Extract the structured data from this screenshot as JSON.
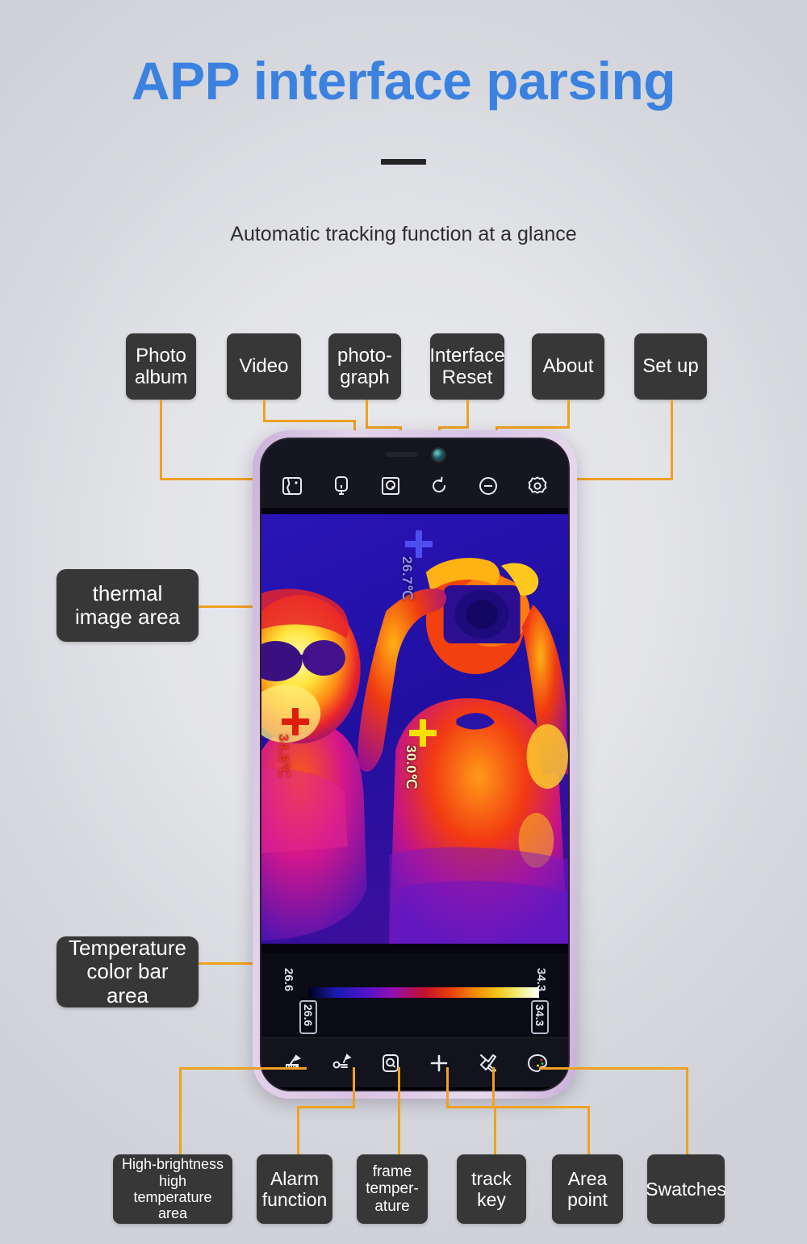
{
  "header": {
    "title": "APP interface parsing",
    "subtitle": "Automatic tracking function at a glance"
  },
  "top_callouts": [
    {
      "label": "Photo album",
      "icon": "photo-album-icon"
    },
    {
      "label": "Video",
      "icon": "video-icon"
    },
    {
      "label": "photo-graph",
      "icon": "photograph-icon"
    },
    {
      "label": "Interface Reset",
      "icon": "interface-reset-icon"
    },
    {
      "label": "About",
      "icon": "about-icon"
    },
    {
      "label": "Set up",
      "icon": "settings-gear-icon"
    }
  ],
  "side_callouts": [
    {
      "label": "thermal image area"
    },
    {
      "label": "Temperature color bar area"
    }
  ],
  "bottom_callouts": [
    {
      "label": "High-brightness high temperature area",
      "icon": "brightness-ruler-icon"
    },
    {
      "label": "Alarm function",
      "icon": "alarm-icon"
    },
    {
      "label": "frame temper-ature",
      "icon": "frame-temperature-icon"
    },
    {
      "label": "track key",
      "icon": "plus-track-icon"
    },
    {
      "label": "Area point",
      "icon": "area-point-icon"
    },
    {
      "label": "Swatches",
      "icon": "palette-icon"
    }
  ],
  "phone": {
    "top_toolbar": [
      "photo-album-icon",
      "video-icon",
      "photograph-icon",
      "interface-reset-icon",
      "about-icon",
      "settings-gear-icon"
    ],
    "bottom_toolbar": [
      "brightness-ruler-icon",
      "alarm-icon",
      "frame-temperature-icon",
      "plus-track-icon",
      "area-point-icon",
      "palette-icon"
    ],
    "thermal_markers": [
      {
        "value": "26.7℃",
        "color": "#4e4ef0",
        "name": "min-temp-marker"
      },
      {
        "value": "34.3℃",
        "color": "#e01b10",
        "name": "max-temp-marker"
      },
      {
        "value": "30.0℃",
        "color": "#f5e000",
        "name": "center-temp-marker"
      }
    ],
    "color_bar": {
      "low_label": "26.6",
      "high_label": "34.3",
      "low_box": "26.6",
      "high_box": "34.3"
    }
  },
  "colors": {
    "title": "#3b82e0",
    "connector": "#f0a020",
    "chip_bg": "#373737",
    "background": "#e3e4e8",
    "phone_frame": "#d9c3e4"
  }
}
